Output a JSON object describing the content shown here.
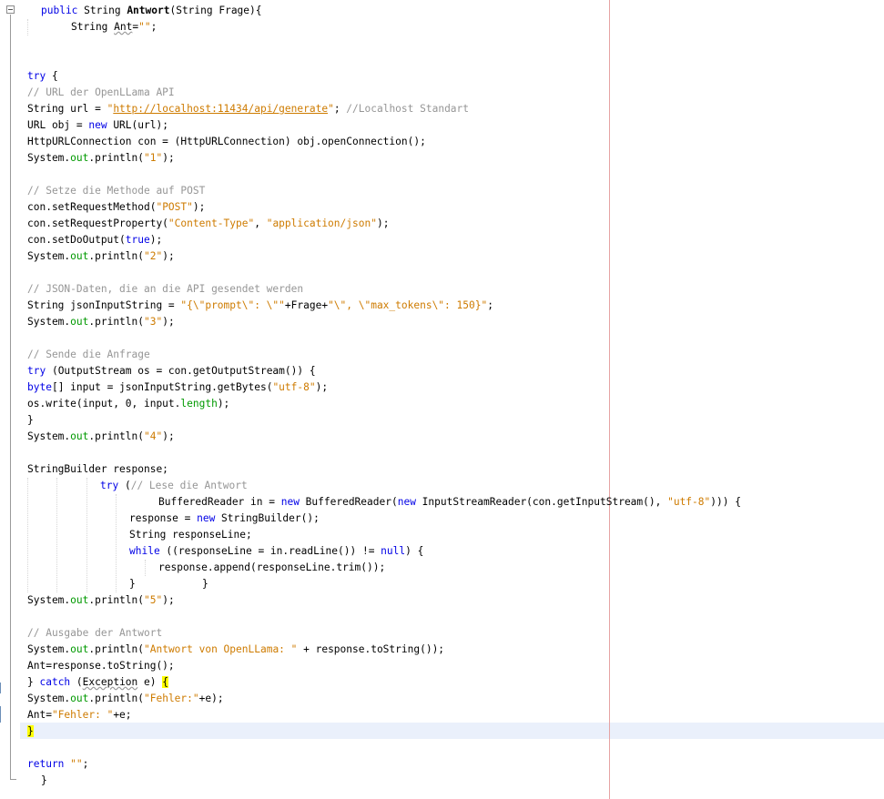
{
  "code": {
    "line01": {
      "kw_public": "public",
      "type_string": " String ",
      "method_name": "Antwort",
      "params": "(String Frage){"
    },
    "line02": {
      "decl_type": "String ",
      "var_ant": "Ant",
      "assign": "=",
      "empty_str": "\"\"",
      "semi": ";"
    },
    "line03": {
      "kw_try": "try",
      "brace": " {"
    },
    "line04": {
      "comment": "// URL der OpenLLama API"
    },
    "line05": {
      "decl": "String url = ",
      "url_open_quote": "\"",
      "url_text": "http://localhost:11434/api/generate",
      "url_close_quote": "\"",
      "semi": "; ",
      "comment": "//Localhost Standart"
    },
    "line06": {
      "pre": "URL obj = ",
      "kw_new": "new",
      "post": " URL(url);"
    },
    "line07": {
      "text": "HttpURLConnection con = (HttpURLConnection) obj.openConnection();"
    },
    "line08": {
      "sys": "System.",
      "out": "out",
      "println": ".println(",
      "str": "\"1\"",
      "end": ");"
    },
    "line09": {
      "comment": "// Setze die Methode auf POST"
    },
    "line10": {
      "pre": "con.setRequestMethod(",
      "str": "\"POST\"",
      "end": ");"
    },
    "line11": {
      "pre": "con.setRequestProperty(",
      "str1": "\"Content-Type\"",
      "mid": ", ",
      "str2": "\"application/json\"",
      "end": ");"
    },
    "line12": {
      "pre": "con.setDoOutput(",
      "kw_true": "true",
      "end": ");"
    },
    "line13": {
      "sys": "System.",
      "out": "out",
      "println": ".println(",
      "str": "\"2\"",
      "end": ");"
    },
    "line14": {
      "comment": "// JSON-Daten, die an die API gesendet werden"
    },
    "line15": {
      "pre": "String jsonInputString = ",
      "str1": "\"{\\\"prompt\\\": \\\"\"",
      "mid": "+Frage+",
      "str2": "\"\\\", \\\"max_tokens\\\": 150}\"",
      "end": ";"
    },
    "line16": {
      "sys": "System.",
      "out": "out",
      "println": ".println(",
      "str": "\"3\"",
      "end": ");"
    },
    "line17": {
      "comment": "// Sende die Anfrage"
    },
    "line18": {
      "kw_try": "try",
      "post": " (OutputStream os = con.getOutputStream()) {"
    },
    "line19": {
      "kw_byte": "byte",
      "mid": "[] input = jsonInputString.getBytes(",
      "str": "\"utf-8\"",
      "end": ");"
    },
    "line20": {
      "pre": "os.write(input, 0, input.",
      "field": "length",
      "end": ");"
    },
    "line21": {
      "text": "}"
    },
    "line22": {
      "sys": "System.",
      "out": "out",
      "println": ".println(",
      "str": "\"4\"",
      "end": ");"
    },
    "line23": {
      "text": "StringBuilder response;"
    },
    "line24": {
      "kw_try": "try",
      "paren": " (",
      "comment": "// Lese die Antwort"
    },
    "line25": {
      "pre": "BufferedReader in = ",
      "kw_new1": "new",
      "mid1": " BufferedReader(",
      "kw_new2": "new",
      "mid2": " InputStreamReader(con.getInputStream(), ",
      "str": "\"utf-8\"",
      "end": "))) {"
    },
    "line26": {
      "pre": "response = ",
      "kw_new": "new",
      "post": " StringBuilder();"
    },
    "line27": {
      "text": "String responseLine;"
    },
    "line28": {
      "kw_while": "while",
      "mid": " ((responseLine = in.readLine()) != ",
      "kw_null": "null",
      "end": ") {"
    },
    "line29": {
      "text": "response.append(responseLine.trim());"
    },
    "line30": {
      "brace1": "}",
      "brace2": "}"
    },
    "line31": {
      "sys": "System.",
      "out": "out",
      "println": ".println(",
      "str": "\"5\"",
      "end": ");"
    },
    "line32": {
      "comment": "// Ausgabe der Antwort"
    },
    "line33": {
      "sys": "System.",
      "out": "out",
      "println": ".println(",
      "str": "\"Antwort von OpenLLama: \"",
      "end": " + response.toString());"
    },
    "line34": {
      "text": "Ant=response.toString();"
    },
    "line35": {
      "brace": "} ",
      "kw_catch": "catch",
      "paren": " (",
      "exc": "Exception",
      "post": " e) ",
      "open_brace": "{"
    },
    "line36": {
      "sys": "System.",
      "out": "out",
      "println": ".println(",
      "str": "\"Fehler:\"",
      "end": "+e);"
    },
    "line37": {
      "pre": "Ant=",
      "str": "\"Fehler: \"",
      "end": "+e;"
    },
    "line38": {
      "brace": "}"
    },
    "line39": {
      "kw_return": "return",
      "sp": " ",
      "str": "\"\"",
      "end": ";"
    },
    "line40": {
      "text": "}"
    }
  },
  "colors": {
    "keyword": "#0000e6",
    "string": "#ce7b00",
    "comment": "#969696",
    "field": "#009900",
    "bracket_highlight": "#ffff00",
    "current_line": "#eaf0fb",
    "margin_line": "#e6a3a3"
  }
}
